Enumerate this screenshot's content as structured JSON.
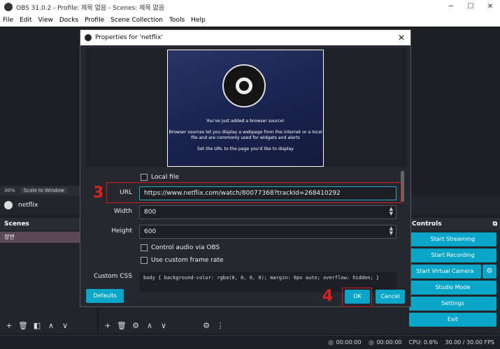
{
  "window": {
    "title": "OBS 31.0.2 - Profile: 제목 없음 - Scenes: 제목 없음",
    "controls": [
      "─",
      "☐",
      "✕"
    ]
  },
  "menu": [
    "File",
    "Edit",
    "View",
    "Docks",
    "Profile",
    "Scene Collection",
    "Tools",
    "Help"
  ],
  "zoom": {
    "percent": "30%",
    "mode": "Scale to Window"
  },
  "source_bar": {
    "name": "netflix"
  },
  "scenes": {
    "title": "Scenes",
    "items": [
      "장면"
    ]
  },
  "controls": {
    "title": "Controls",
    "start_streaming": "Start Streaming",
    "start_recording": "Start Recording",
    "start_virtual_camera": "Start Virtual Camera",
    "studio_mode": "Studio Mode",
    "settings": "Settings",
    "exit": "Exit"
  },
  "status": {
    "stream_time": "00:00:00",
    "record_time": "00:00:00",
    "cpu": "CPU: 0.6%",
    "fps": "30.00 / 30.00 FPS"
  },
  "dialog": {
    "title": "Properties for 'netflix'",
    "preview_text": {
      "line1": "You've just added a browser source!",
      "line2": "Browser sources let you display a webpage from the internet or a local",
      "line3": "file and are commonly used for widgets and alerts",
      "line4": "Set the URL to the page you'd like to display"
    },
    "local_file_label": "Local file",
    "url_label": "URL",
    "url_value": "https://www.netflix.com/watch/80077368?trackId=268410292",
    "width_label": "Width",
    "width_value": "800",
    "height_label": "Height",
    "height_value": "600",
    "control_audio_label": "Control audio via OBS",
    "custom_frame_rate_label": "Use custom frame rate",
    "custom_css_label": "Custom CSS",
    "custom_css_value": "body { background-color: rgba(0, 0, 0, 0); margin: 0px auto; overflow: hidden; }",
    "defaults_button": "Defaults",
    "ok_button": "OK",
    "cancel_button": "Cancel"
  },
  "annotations": {
    "step3": "3",
    "step4": "4"
  },
  "colors": {
    "accent": "#0aa6c9",
    "annotation": "#e0201c"
  }
}
